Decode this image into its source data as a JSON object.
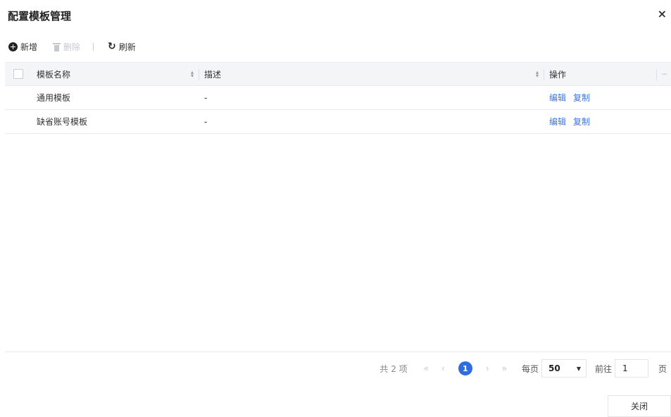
{
  "dialog": {
    "title": "配置模板管理",
    "close_glyph": "×"
  },
  "toolbar": {
    "add_label": "新增",
    "delete_label": "删除",
    "separator": "|",
    "refresh_label": "刷新"
  },
  "table": {
    "headers": {
      "name": "模板名称",
      "description": "描述",
      "actions": "操作",
      "more": "···"
    },
    "rows": [
      {
        "name": "通用模板",
        "description": "-",
        "edit": "编辑",
        "copy": "复制"
      },
      {
        "name": "缺省账号模板",
        "description": "-",
        "edit": "编辑",
        "copy": "复制"
      }
    ]
  },
  "pagination": {
    "total_text": "共 2 项",
    "first": "«",
    "prev": "‹",
    "current_page": "1",
    "next": "›",
    "last": "»",
    "page_size_label": "每页",
    "page_size": "50",
    "goto_label": "前往",
    "goto_value": "1",
    "goto_suffix": "页"
  },
  "footer": {
    "close_label": "关闭"
  }
}
